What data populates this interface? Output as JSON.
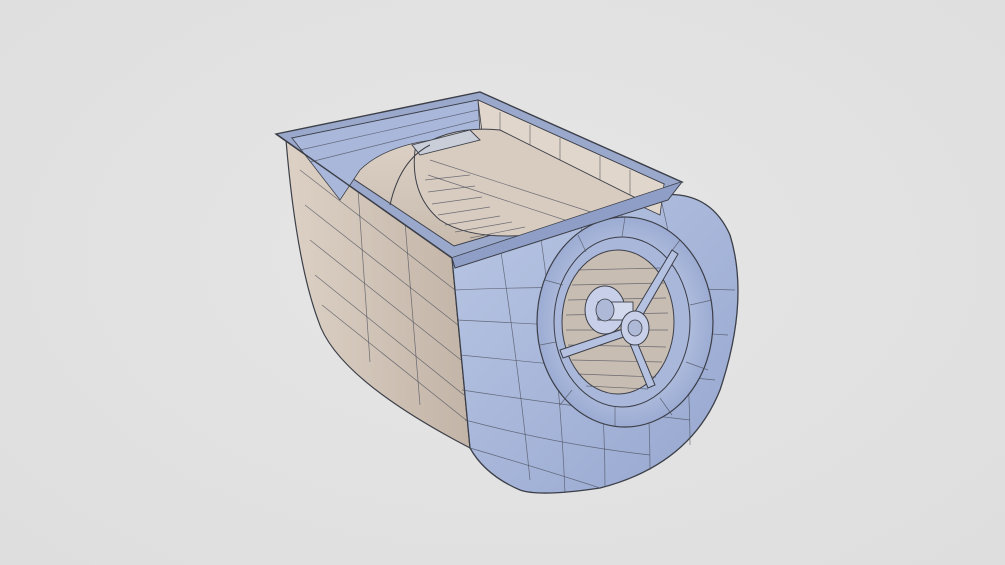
{
  "scene": {
    "background": "#e2e2e2",
    "object": "centrifugal-blower-wireframe-model",
    "colors": {
      "blue_face": "#a4b3d6",
      "blue_light": "#b9c5e2",
      "tan_face": "#c9bcb0",
      "tan_light": "#ddd1c6",
      "edge": "#3c3f48"
    }
  }
}
